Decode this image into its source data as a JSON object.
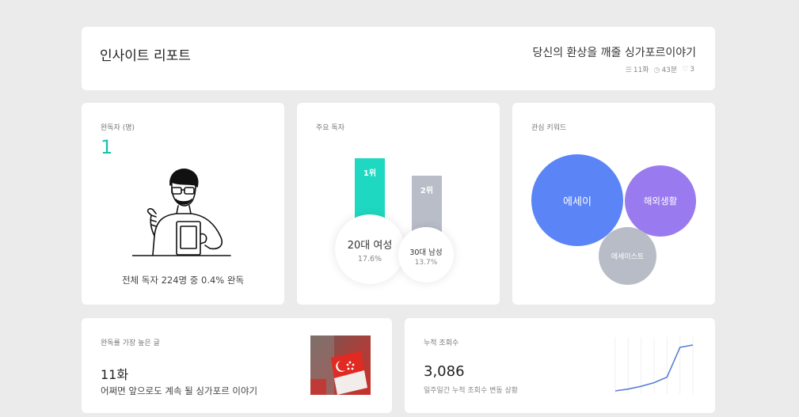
{
  "header": {
    "title": "인사이트 리포트",
    "book_title": "당신의 환상을 깨줄 싱가포르이야기",
    "episodes": "11화",
    "read_time": "43분",
    "likes": "3"
  },
  "completed_readers": {
    "label": "완독자 (명)",
    "value": "1",
    "footer": "전체 독자 224명 중 0.4% 완독"
  },
  "main_readers": {
    "label": "주요 독자",
    "ranks": [
      {
        "rank": "1위",
        "group": "20대 여성",
        "percent": "17.6%",
        "share": 17.6,
        "color": "#1fd8c1"
      },
      {
        "rank": "2위",
        "group": "30대 남성",
        "percent": "13.7%",
        "share": 13.7,
        "color": "#b8bdc8"
      }
    ]
  },
  "keywords": {
    "label": "관심 키워드",
    "items": [
      {
        "text": "에세이",
        "color": "#5b84f7"
      },
      {
        "text": "해외생활",
        "color": "#9a7bef"
      },
      {
        "text": "에세이스트",
        "color": "#b8bcc6"
      }
    ]
  },
  "most_read": {
    "label": "완독률 가장 높은 글",
    "episode": "11화",
    "title": "어쩌면 앞으로도 계속 될 싱가포르 이야기"
  },
  "cumulative_views": {
    "label": "누적 조회수",
    "value": "3,086",
    "subtitle": "일주일간 누적 조회수 변동 상황",
    "trend": [
      0,
      4,
      10,
      18,
      30,
      95,
      100
    ],
    "line_color": "#5b7fd6"
  }
}
